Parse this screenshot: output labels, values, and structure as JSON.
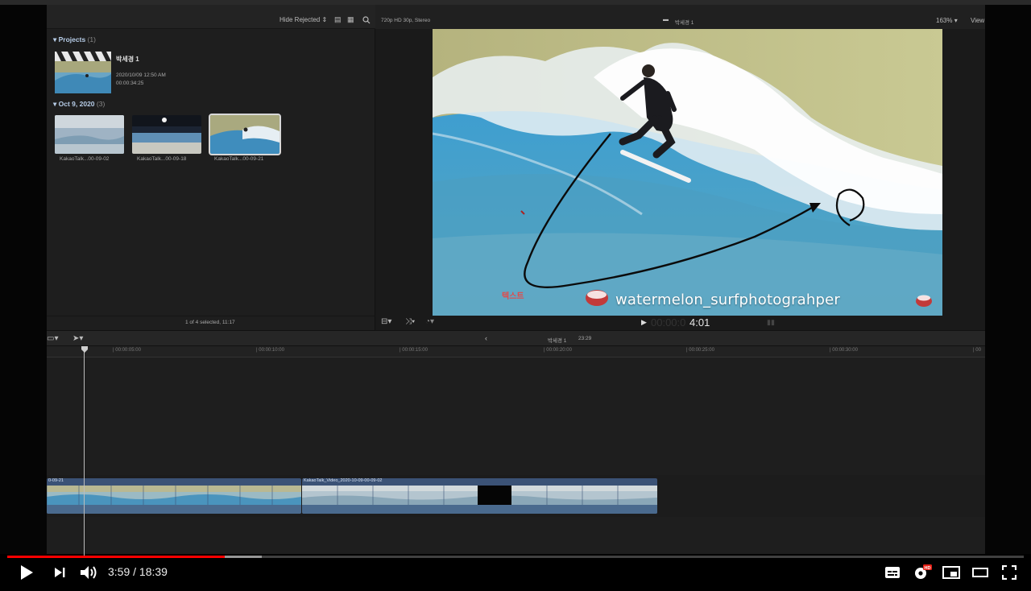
{
  "browser": {
    "filter_label": "Hide Rejected",
    "projects_heading": "Projects",
    "projects_count": "(1)",
    "project": {
      "name": "박세경 1",
      "date": "2020/10/09 12:50 AM",
      "duration": "00:00:34:25"
    },
    "event_heading": "Oct 9, 2020",
    "event_count": "(3)",
    "clips": [
      {
        "label": "KakaoTalk...00-09-02"
      },
      {
        "label": "KakaoTalk...00-09-18"
      },
      {
        "label": "KakaoTalk...00-09-21"
      }
    ],
    "status": "1 of 4 selected, 11:17"
  },
  "viewer": {
    "format": "720p HD 30p, Stereo",
    "project_title": "박세경 1",
    "zoom": "163%",
    "view_label": "View",
    "timecode": "4:01",
    "overlay_text": "텍스트",
    "watermark": "watermelon_surfphotograhper"
  },
  "timeline": {
    "title": "박세경 1",
    "duration": "23:29",
    "ticks": [
      "00:00:05:00",
      "00:00:10:00",
      "00:00:15:00",
      "00:00:20:00",
      "00:00:25:00",
      "00:00:30:00",
      "00"
    ],
    "clip1_title": "0-09-21",
    "clip2_title": "KakaoTalk_Video_2020-10-09-00-09-02"
  },
  "player": {
    "time": "3:59 / 18:39",
    "progress_played": 0.214,
    "progress_buffered": 0.25,
    "accent": "#ff0000"
  },
  "icons": [
    "play-icon",
    "next-icon",
    "volume-icon",
    "subtitles-icon",
    "settings-icon",
    "miniplayer-icon",
    "theater-icon",
    "fullscreen-icon"
  ]
}
